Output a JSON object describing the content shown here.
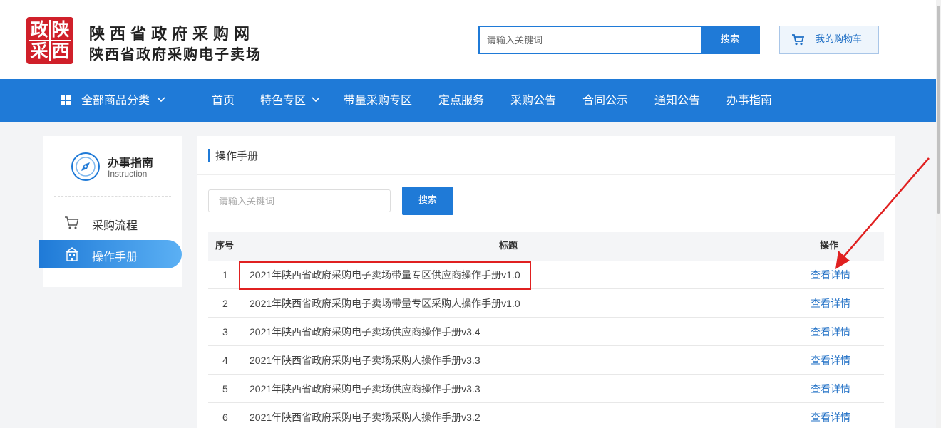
{
  "header": {
    "logo_chars": [
      "政",
      "陕",
      "采",
      "西"
    ],
    "title_line1": "陕西省政府采购网",
    "title_line2": "陕西省政府采购电子卖场",
    "search_placeholder": "请输入关键词",
    "search_button": "搜索",
    "cart_label": "我的购物车"
  },
  "nav": {
    "category_label": "全部商品分类",
    "items": [
      "首页",
      "特色专区",
      "带量采购专区",
      "定点服务",
      "采购公告",
      "合同公示",
      "通知公告",
      "办事指南"
    ]
  },
  "sidebar": {
    "title": "办事指南",
    "subtitle": "Instruction",
    "items": [
      {
        "label": "采购流程",
        "icon": "cart-icon"
      },
      {
        "label": "操作手册",
        "icon": "document-icon",
        "active": true
      }
    ]
  },
  "main": {
    "panel_title": "操作手册",
    "filter_placeholder": "请输入关键词",
    "filter_button": "搜索",
    "columns": [
      "序号",
      "标题",
      "操作"
    ],
    "rows": [
      {
        "idx": "1",
        "title": "2021年陕西省政府采购电子卖场带量专区供应商操作手册v1.0",
        "op": "查看详情"
      },
      {
        "idx": "2",
        "title": "2021年陕西省政府采购电子卖场带量专区采购人操作手册v1.0",
        "op": "查看详情"
      },
      {
        "idx": "3",
        "title": "2021年陕西省政府采购电子卖场供应商操作手册v3.4",
        "op": "查看详情"
      },
      {
        "idx": "4",
        "title": "2021年陕西省政府采购电子卖场采购人操作手册v3.3",
        "op": "查看详情"
      },
      {
        "idx": "5",
        "title": "2021年陕西省政府采购电子卖场供应商操作手册v3.3",
        "op": "查看详情"
      },
      {
        "idx": "6",
        "title": "2021年陕西省政府采购电子卖场采购人操作手册v3.2",
        "op": "查看详情"
      }
    ]
  },
  "colors": {
    "primary": "#1f7ad7",
    "logo_red": "#d0202a",
    "annotation_red": "#e02020"
  }
}
